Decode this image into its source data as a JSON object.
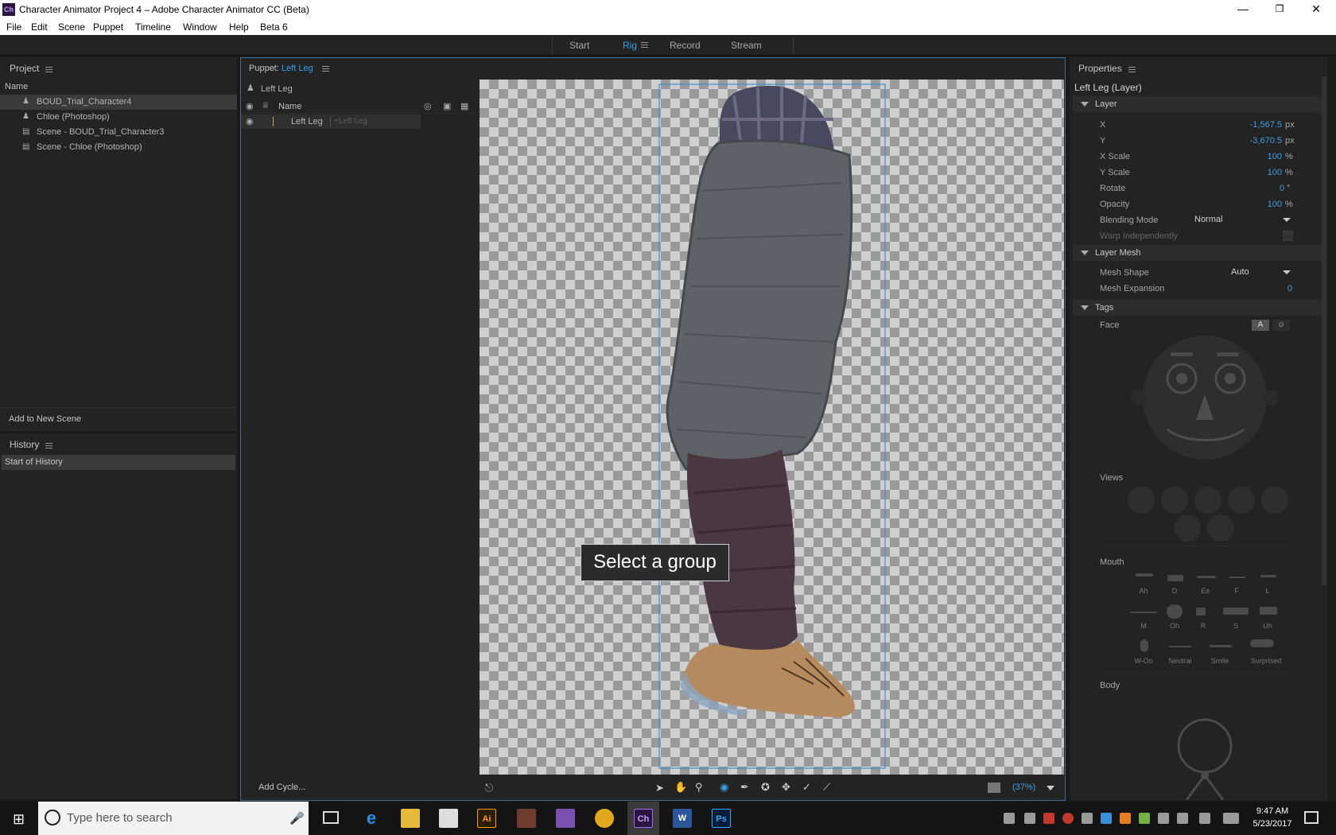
{
  "window": {
    "title": "Character Animator Project 4 – Adobe Character Animator CC (Beta)",
    "app_icon_text": "Ch",
    "minimize": "—",
    "restore": "❐",
    "close": "✕"
  },
  "menu": [
    "File",
    "Edit",
    "Scene",
    "Puppet",
    "Timeline",
    "Window",
    "Help",
    "Beta 6"
  ],
  "modes": {
    "start": "Start",
    "rig": "Rig",
    "record": "Record",
    "stream": "Stream"
  },
  "project": {
    "title": "Project",
    "column": "Name",
    "items": [
      "BOUD_Trial_Character4",
      "Chloe (Photoshop)",
      "Scene - BOUD_Trial_Character3",
      "Scene - Chloe (Photoshop)"
    ],
    "add_button": "Add to New Scene"
  },
  "history": {
    "title": "History",
    "items": [
      "Start of History"
    ]
  },
  "puppet": {
    "label": "Puppet:",
    "name": "Left Leg",
    "breadcrumb": "Left Leg",
    "column": "Name",
    "layer_name": "Left Leg",
    "layer_tag": "+Left Leg",
    "add_cycle": "Add Cycle..."
  },
  "canvas": {
    "tooltip": "Select a group",
    "zoom": "(37%)"
  },
  "properties": {
    "title": "Properties",
    "subject": "Left Leg (Layer)",
    "layer_section": "Layer",
    "fields": {
      "x_label": "X",
      "x_value": "-1,567.5",
      "x_unit": "px",
      "y_label": "Y",
      "y_value": "-3,670.5",
      "y_unit": "px",
      "xscale_label": "X Scale",
      "xscale_value": "100",
      "xscale_unit": "%",
      "yscale_label": "Y Scale",
      "yscale_value": "100",
      "yscale_unit": "%",
      "rotate_label": "Rotate",
      "rotate_value": "0",
      "rotate_unit": "°",
      "opacity_label": "Opacity",
      "opacity_value": "100",
      "opacity_unit": "%",
      "blend_label": "Blending Mode",
      "blend_value": "Normal",
      "warp_label": "Warp Independently"
    },
    "mesh_section": "Layer Mesh",
    "mesh": {
      "shape_label": "Mesh Shape",
      "shape_value": "Auto",
      "expansion_label": "Mesh Expansion",
      "expansion_value": "0"
    },
    "tags_section": "Tags",
    "tags": {
      "face_label": "Face",
      "face_btn_a": "A",
      "views_label": "Views",
      "mouth_label": "Mouth",
      "body_label": "Body"
    },
    "mouth_shapes": [
      "Ah",
      "D",
      "Ee",
      "F",
      "L",
      "M",
      "Oh",
      "R",
      "S",
      "Uh",
      "W-Oo",
      "Neutral",
      "Smile",
      "Surprised"
    ]
  },
  "taskbar": {
    "search_placeholder": "Type here to search",
    "time": "9:47 AM",
    "date": "5/23/2017",
    "apps": [
      "Ai",
      "Ch",
      "Ps"
    ]
  }
}
